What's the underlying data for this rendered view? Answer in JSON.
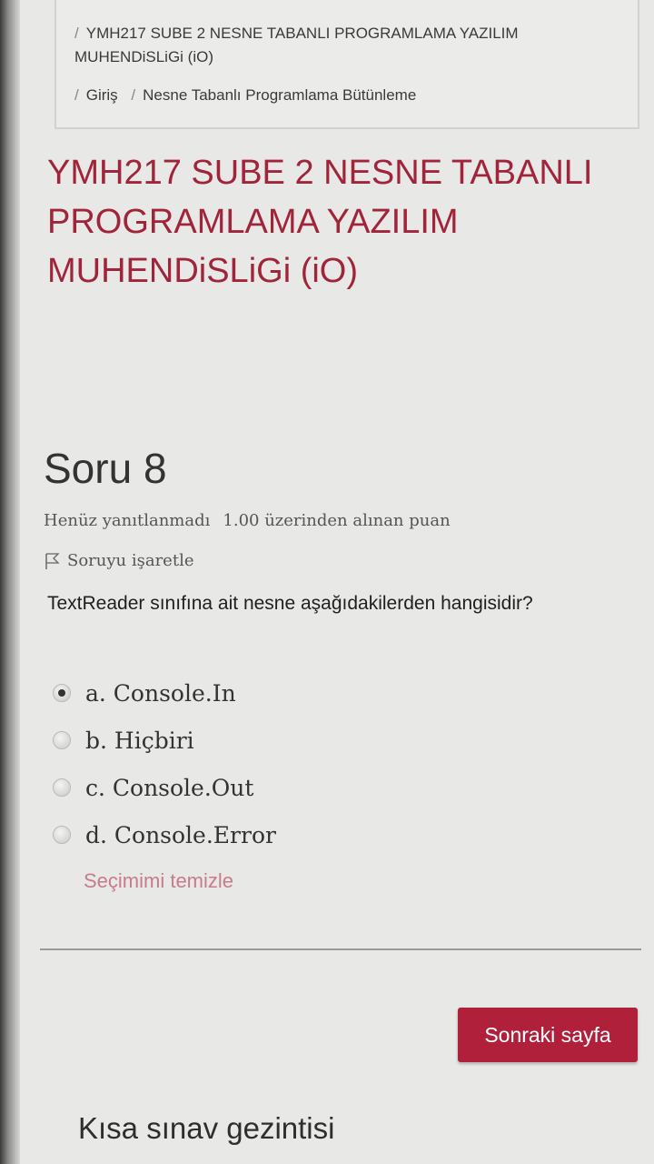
{
  "breadcrumb": {
    "row1": "YMH217 SUBE 2 NESNE TABANLI PROGRAMLAMA YAZILIM MUHENDiSLiGi (iO)",
    "separator": "/",
    "home": "Giriş",
    "quiz": "Nesne Tabanlı Programlama Bütünleme"
  },
  "course_title": "YMH217 SUBE 2 NESNE TABANLI PROGRAMLAMA YAZILIM MUHENDiSLiGi (iO)",
  "question": {
    "number": "Soru 8",
    "state": "Henüz yanıtlanmadı",
    "mark": "1.00 üzerinden alınan puan",
    "flag_label": "Soruyu işaretle",
    "text": "TextReader sınıfına ait nesne aşağıdakilerden hangisidir?",
    "answers": [
      {
        "label": "a. Console.In",
        "checked": true
      },
      {
        "label": "b. Hiçbiri",
        "checked": false
      },
      {
        "label": "c. Console.Out",
        "checked": false
      },
      {
        "label": "d. Console.Error",
        "checked": false
      }
    ],
    "clear_choice": "Seçimimi temizle"
  },
  "navigation": {
    "next_button": "Sonraki sayfa",
    "quiz_nav_title": "Kısa sınav gezintisi"
  },
  "colors": {
    "accent": "#b1203a",
    "title": "#a0253a"
  }
}
